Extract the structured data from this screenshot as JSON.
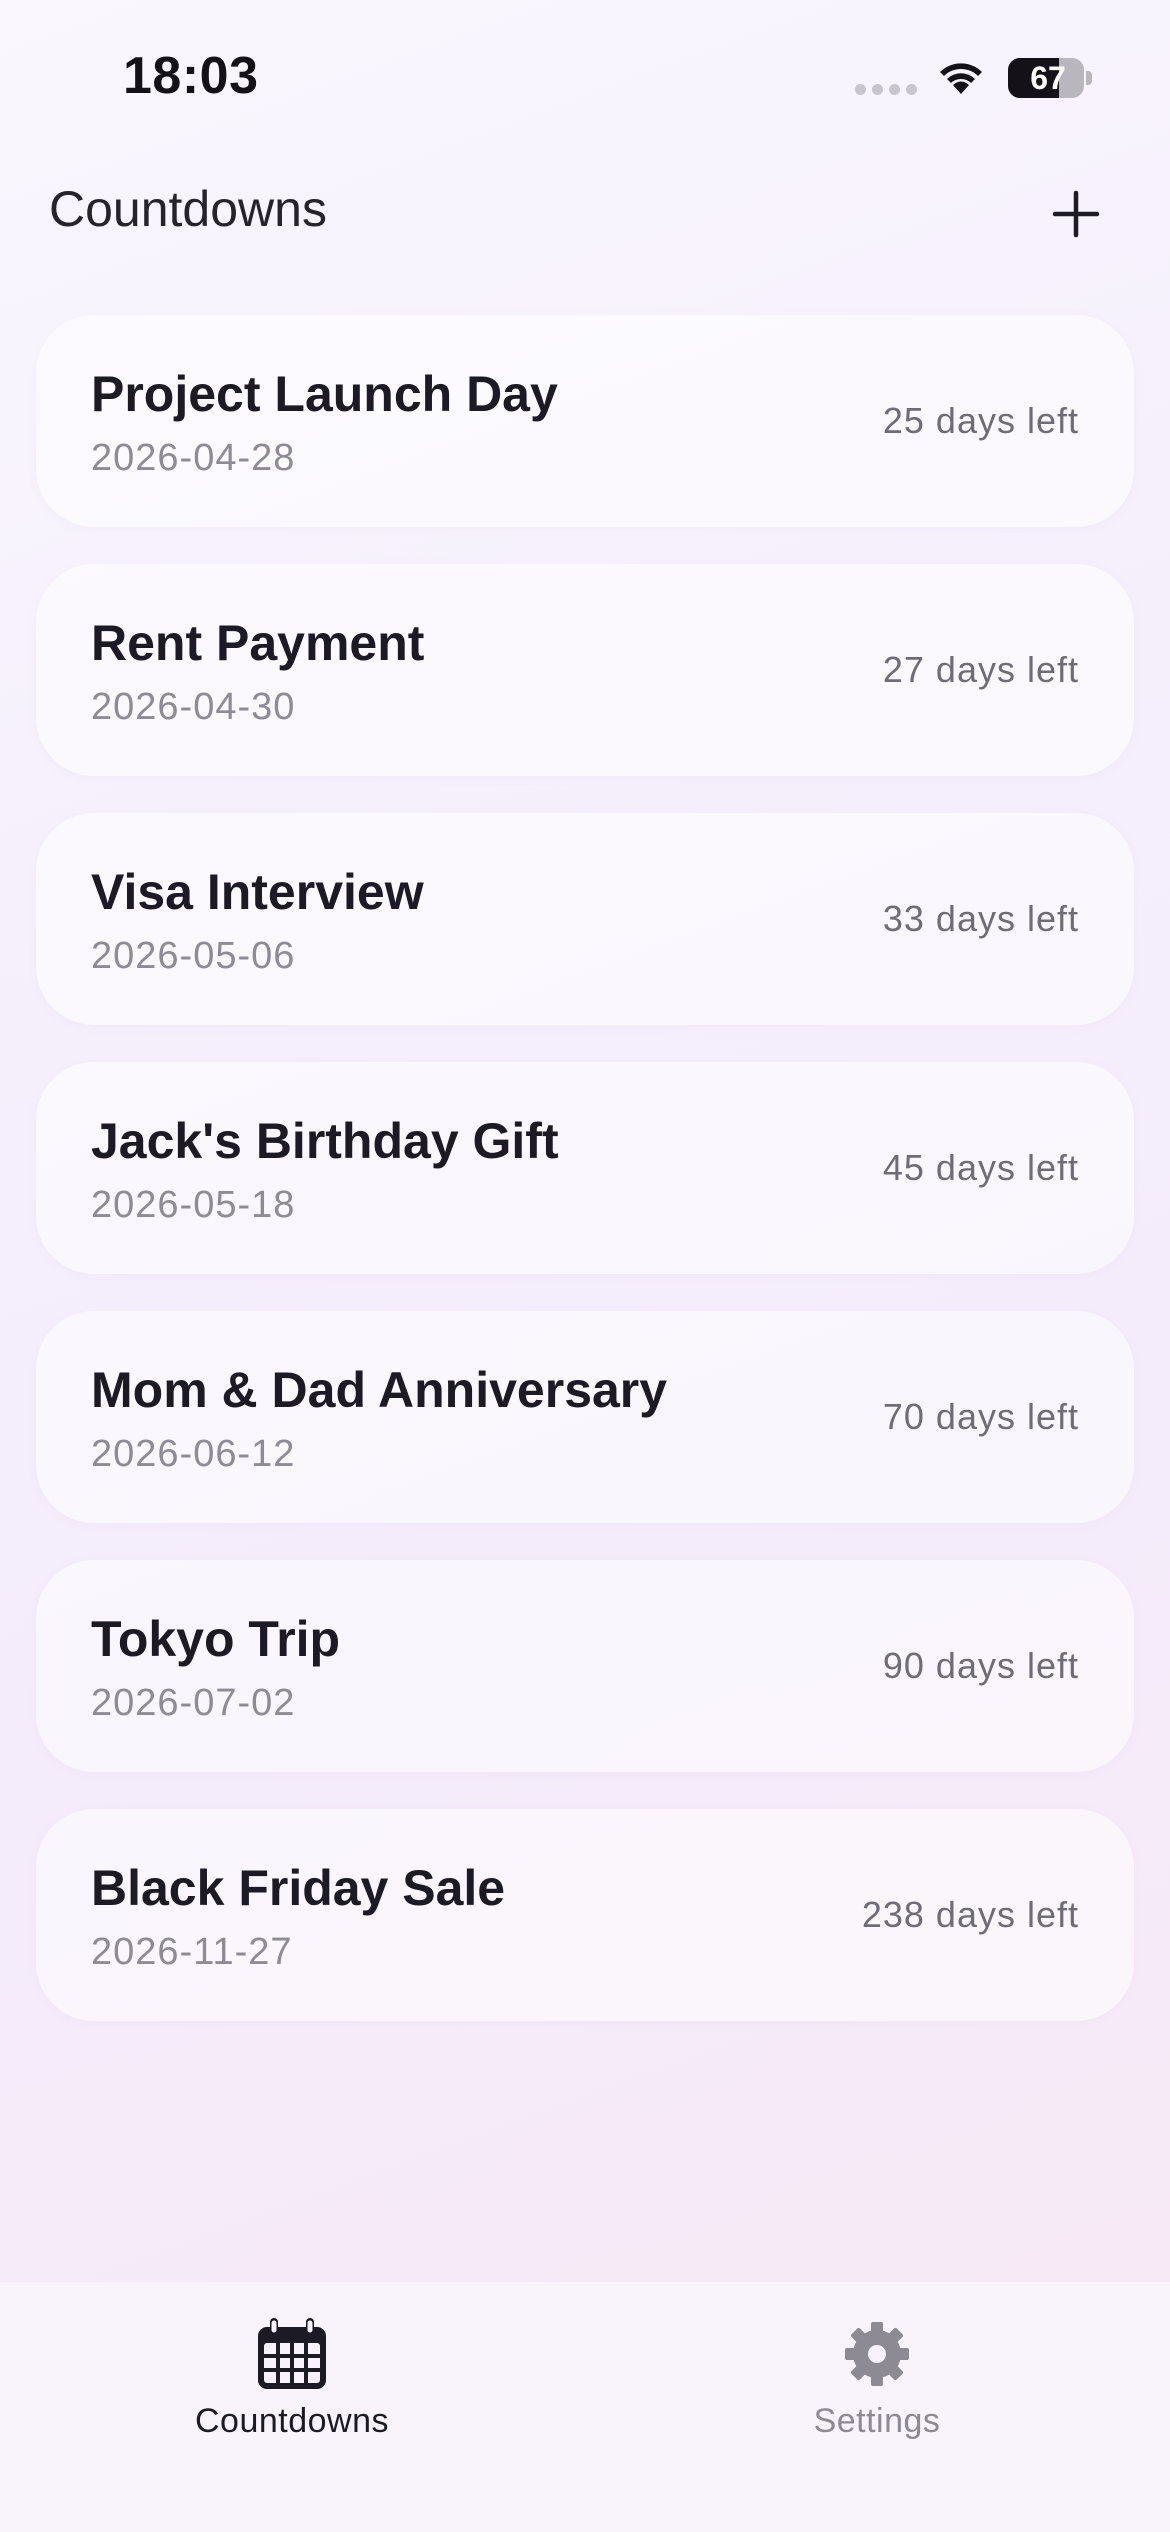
{
  "status_bar": {
    "time": "18:03",
    "battery_level": 67,
    "battery_label": "67"
  },
  "header": {
    "title": "Countdowns",
    "add_icon": "plus-icon"
  },
  "countdowns": [
    {
      "title": "Project Launch Day",
      "date": "2026-04-28",
      "days_left": "25 days left"
    },
    {
      "title": "Rent Payment",
      "date": "2026-04-30",
      "days_left": "27 days left"
    },
    {
      "title": "Visa Interview",
      "date": "2026-05-06",
      "days_left": "33 days left"
    },
    {
      "title": "Jack's Birthday Gift",
      "date": "2026-05-18",
      "days_left": "45 days left"
    },
    {
      "title": "Mom & Dad Anniversary",
      "date": "2026-06-12",
      "days_left": "70 days left"
    },
    {
      "title": "Tokyo Trip",
      "date": "2026-07-02",
      "days_left": "90 days left"
    },
    {
      "title": "Black Friday Sale",
      "date": "2026-11-27",
      "days_left": "238 days left"
    }
  ],
  "tab_bar": {
    "tabs": [
      {
        "label": "Countdowns",
        "icon": "calendar-icon",
        "active": true
      },
      {
        "label": "Settings",
        "icon": "gear-icon",
        "active": false
      }
    ]
  },
  "colors": {
    "text_primary": "#1c1a24",
    "text_secondary": "#8e8b96",
    "tab_inactive": "#8d8a94",
    "card_background": "#ffffff"
  }
}
